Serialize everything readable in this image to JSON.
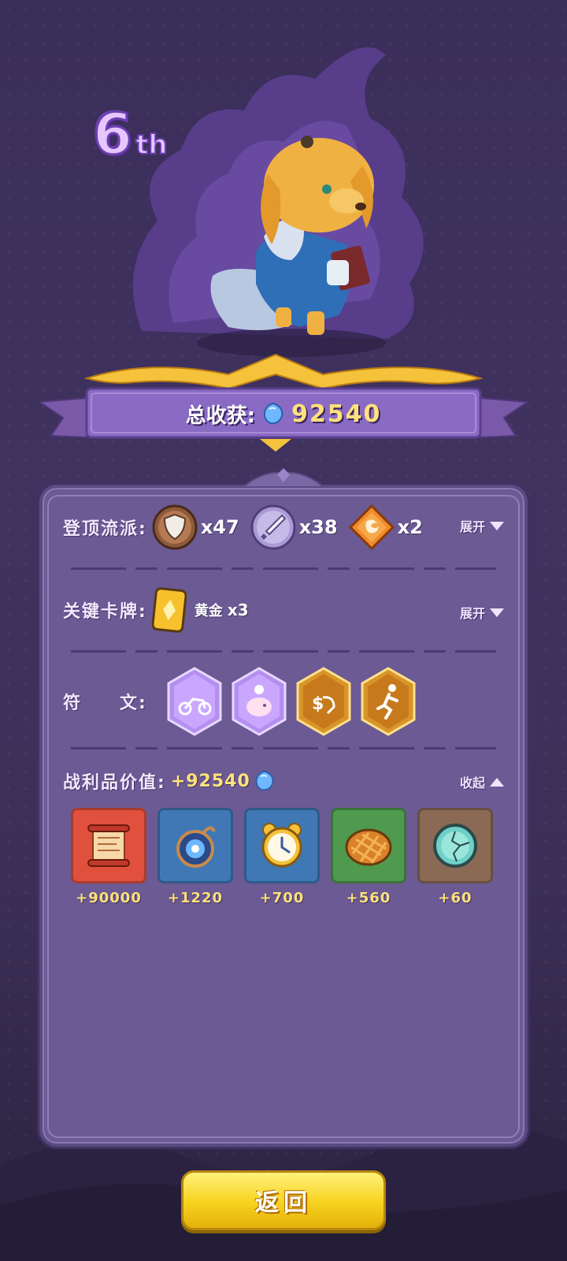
{
  "rank": {
    "number": "6",
    "suffix": "th"
  },
  "total": {
    "label": "总收获:",
    "value": "92540",
    "icon": "blue-gem-icon"
  },
  "school": {
    "label": "登顶流派:",
    "items": [
      {
        "icon": "shield-icon",
        "count": "x47"
      },
      {
        "icon": "sword-icon",
        "count": "x38"
      },
      {
        "icon": "flame-swirl-icon",
        "count": "x2"
      }
    ],
    "toggle": "展开"
  },
  "cards": {
    "label": "关键卡牌:",
    "card_icon": "gold-card-icon",
    "card_name": "黄金",
    "card_count": "x3",
    "toggle": "展开"
  },
  "runes": {
    "label": "符　　文:",
    "items": [
      "motorcycle-rune-icon",
      "piggy-bank-rune-icon",
      "slot-machine-rune-icon",
      "runner-rune-icon"
    ]
  },
  "loot": {
    "label": "战利品价值:",
    "value": "+92540",
    "toggle": "收起",
    "items": [
      {
        "icon": "scroll-icon",
        "value": "+90000",
        "bg": "#e0503d"
      },
      {
        "icon": "blue-charm-icon",
        "value": "+1220",
        "bg": "#3f78b5"
      },
      {
        "icon": "alarm-clock-icon",
        "value": "+700",
        "bg": "#3f78b5"
      },
      {
        "icon": "bread-icon",
        "value": "+560",
        "bg": "#4f9a4e"
      },
      {
        "icon": "cracked-orb-icon",
        "value": "+60",
        "bg": "#8a6a55"
      }
    ]
  },
  "back_button": "返回"
}
